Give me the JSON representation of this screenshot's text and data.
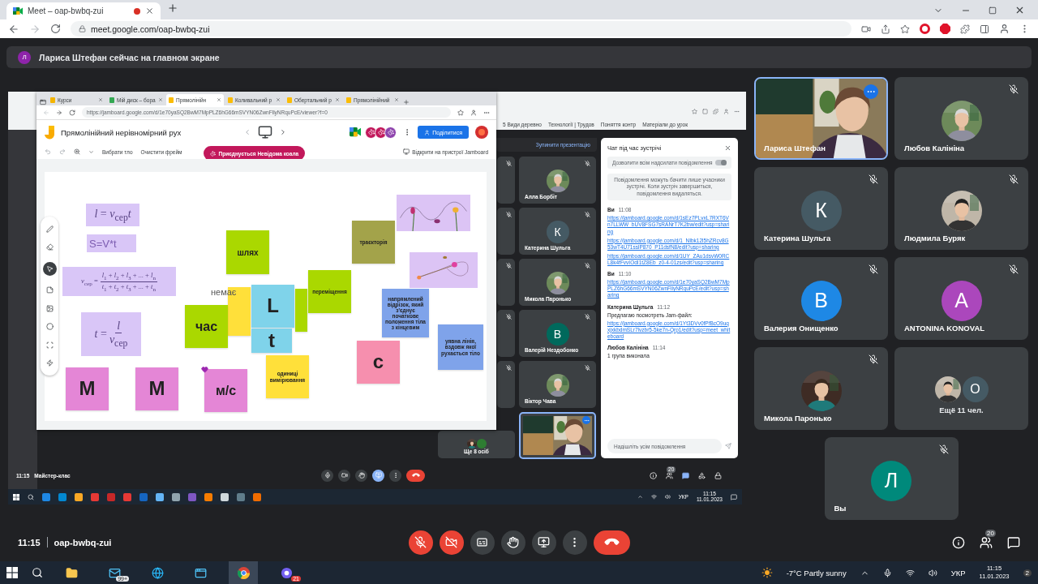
{
  "browser": {
    "tab": "Meet – oap-bwbq-zui",
    "url": "meet.google.com/oap-bwbq-zui"
  },
  "banner": {
    "avatar": "Л",
    "text": "Лариса Штефан сейчас на главном экране"
  },
  "shared": {
    "back_bookmarks": [
      "5 Види деревно",
      "Технології | Трудов",
      "Поняття контр",
      "Матеріали до урок"
    ],
    "inner_browser": {
      "tabs": [
        {
          "label": "Курси",
          "selected": false
        },
        {
          "label": "Мій диск – бора",
          "selected": false
        },
        {
          "label": "Прямолінійн",
          "selected": true
        },
        {
          "label": "Коливальний р",
          "selected": false
        },
        {
          "label": "Обертальний р",
          "selected": false
        },
        {
          "label": "Прямолінійний",
          "selected": false
        }
      ],
      "url": "https://jamboard.google.com/d/1e70yaSQ2BwM7MpPLZ6hG66mSVYN06ZwnFllyNRquPcE/viewer?f=0"
    },
    "jamboard": {
      "title": "Прямолінійний нерівномірний рух",
      "share": "Поділитися",
      "background_button": "Вибрати тло",
      "clear_button": "Очистити фрейм",
      "joined_chip": "Приєднується Невідома коала",
      "open_device": "Відкрити на пристрої Jamboard",
      "items": [
        {
          "kind": "formula",
          "text": "*l* = *v*$_{сер}$*t*"
        },
        {
          "kind": "text_box",
          "text": "S=V*t"
        },
        {
          "kind": "fraction",
          "left": "*v*$_{сер}$ =",
          "numerator": "*l*$_{1}$ + *l*$_{2}$ + *l*$_{3}$ + ... + *l*$_{n}$",
          "denominator": "*t*$_{1}$ + *t*$_{2}$ + *t*$_{3}$ + ... + *t*$_{n}$"
        },
        {
          "kind": "fraction",
          "left": "*t* =",
          "numerator": "*l*",
          "denominator": "*v*$_{сер}$"
        },
        {
          "kind": "sticky",
          "color": "#e486d6",
          "text": "М"
        },
        {
          "kind": "sticky",
          "color": "#e486d6",
          "text": "М"
        },
        {
          "kind": "sticky",
          "color": "#e486d6",
          "text": "м/с"
        },
        {
          "kind": "sticky",
          "color": "#aad800",
          "text": "шлях"
        },
        {
          "kind": "sticky",
          "color": "#ffe03a"
        },
        {
          "kind": "label",
          "text": "немає"
        },
        {
          "kind": "sticky",
          "color": "#aad800",
          "text": "час"
        },
        {
          "kind": "sticky",
          "color": "#aad800"
        },
        {
          "kind": "sticky",
          "color": "#7fd3ea",
          "text": "L"
        },
        {
          "kind": "sticky",
          "color": "#7fd3ea",
          "text": "t"
        },
        {
          "kind": "sticky",
          "color": "#aad800",
          "text": "переміщення"
        },
        {
          "kind": "sticky",
          "color": "#ffe03a",
          "text": "одиниці вимірювання"
        },
        {
          "kind": "sticky",
          "color": "#a3a34a",
          "text": "траєкторія"
        },
        {
          "kind": "picture"
        },
        {
          "kind": "picture"
        },
        {
          "kind": "sticky",
          "color": "#7fa3ea",
          "text": "напрямлений відрізок, який з'єднує початкове положення тіла з кінцевим"
        },
        {
          "kind": "sticky",
          "color": "#f68fae",
          "text": "с"
        },
        {
          "kind": "sticky",
          "color": "#7fa3ea",
          "text": "уявна лінія, вздовж якої рухається тіло"
        }
      ]
    },
    "stop_presenting": "Зупинити презентацію",
    "tiles": [
      {
        "kind": "covered",
        "muted": true
      },
      {
        "name": "Алла Борбіт",
        "muted": true
      },
      {
        "kind": "covered",
        "muted": true
      },
      {
        "kind": "letter",
        "name": "Катерина Шульга",
        "letter": "К",
        "color": "#455a64",
        "muted": true
      },
      {
        "kind": "covered",
        "muted": true
      },
      {
        "name": "Микола Паронько",
        "muted": true
      },
      {
        "kind": "covered",
        "muted": true
      },
      {
        "kind": "letter",
        "name": "Валерій Нездобонко",
        "letter": "В",
        "color": "#00695c",
        "muted": true
      },
      {
        "kind": "covered",
        "muted": true
      },
      {
        "name": "Віктор Чава",
        "muted": true
      },
      {
        "kind": "others",
        "name": "Ще 8 осіб",
        "muted": false
      },
      {
        "kind": "video",
        "muted": false
      }
    ],
    "chat": {
      "title": "Чат під час зустрічі",
      "allow_label": "Дозволити всім надсилати повідомлення",
      "allow_on": true,
      "notice": "Повідомлення можуть бачити лише учасники зустрічі. Коли зустріч завершиться, повідомлення видаляться.",
      "messages": [
        {
          "sender": "Ви",
          "time": "11:08",
          "lines": [
            {
              "kind": "link",
              "text": "https://jamboard.google.com/d/1sEz7PLvxL7RXT6Vn7LLWW_bUV8FSG7sRANrT7K2bw/edit?usp=sharing"
            },
            {
              "kind": "link",
              "text": "https://jamboard.google.com/d/1_NIbk12l5hZRcv8G53wT4U71sslP870_P11dsfN8/edit?usp=sharing"
            },
            {
              "kind": "link",
              "text": "https://jamboard.google.com/d/1UY_ZAu1dsvW0RCL8k4fFvvIOdI1tZ8Eb_z0-4-01zs/edit?usp=sharing"
            }
          ]
        },
        {
          "sender": "Ви",
          "time": "11:10",
          "lines": [
            {
              "kind": "link",
              "text": "https://jamboard.google.com/d/1e70yaSQ2BwM7MpPLZ6hG66mSVYN06ZwnFllyNRquPcE/edit?usp=sharing"
            }
          ]
        },
        {
          "sender": "Катерина Шульга",
          "time": "11:12",
          "lines": [
            {
              "kind": "text",
              "text": "Предлагаю посмотреть Jam-файл:"
            },
            {
              "kind": "link",
              "text": "https://jamboard.google.com/d/1Yt3DVv0fPfBcO9uqxjxkbdmSLr7lvzbr5-5ke7n-Qrp1/edit?usp=meet_whiteboard"
            }
          ]
        },
        {
          "sender": "Любов Калініна",
          "time": "11:14",
          "lines": [
            {
              "kind": "text",
              "text": "1 група  виконала"
            }
          ]
        }
      ],
      "placeholder": "Надішліть усім повідомлення"
    },
    "bar": {
      "time": "11:15",
      "title": "Майстер-клас",
      "people_count": "20",
      "controls": [
        {
          "kind": "mic",
          "color": "#3c4043"
        },
        {
          "kind": "camera",
          "color": "#3c4043"
        },
        {
          "kind": "hand",
          "color": "#3c4043"
        },
        {
          "kind": "present",
          "color": "#8ab4f8"
        },
        {
          "kind": "more",
          "color": "#3c4043"
        },
        {
          "kind": "hangup",
          "color": "#ea4335"
        }
      ]
    },
    "taskbar": {
      "lang": "УКР",
      "time": "11:15",
      "date": "11.01.2023"
    }
  },
  "tiles": [
    {
      "kind": "video",
      "name": "Лариса Штефан",
      "muted": false,
      "highlighted": true
    },
    {
      "name": "Любов Калініна",
      "muted": true,
      "highlighted": false
    },
    {
      "kind": "letter",
      "name": "Катерина Шульга",
      "letter": "К",
      "color": "#455a64",
      "muted": true,
      "highlighted": false
    },
    {
      "name": "Людмила Буряк",
      "muted": true,
      "highlighted": false
    },
    {
      "kind": "letter",
      "name": "Валерия Онищенко",
      "letter": "В",
      "color": "#1e88e5",
      "muted": true,
      "highlighted": false
    },
    {
      "kind": "letter",
      "name": "ANTONINA KONOVAL",
      "letter": "A",
      "color": "#ab47bc",
      "muted": true,
      "highlighted": false
    },
    {
      "name": "Микола Паронько",
      "muted": true,
      "highlighted": false
    },
    {
      "kind": "others",
      "name": "Ещё 11 чел.",
      "letter": "О",
      "color": "#455a64",
      "muted": false,
      "highlighted": false
    },
    {
      "kind": "letter",
      "name": "Вы",
      "letter": "Л",
      "color": "#00897b",
      "muted": true,
      "highlighted": false
    }
  ],
  "bottom": {
    "time": "11:15",
    "code": "oap-bwbq-zui",
    "people_count": "20",
    "controls": [
      {
        "kind": "mic_off",
        "color": "#ea4335"
      },
      {
        "kind": "camera_off",
        "color": "#ea4335"
      },
      {
        "kind": "captions",
        "color": "#3c4043"
      },
      {
        "kind": "hand",
        "color": "#3c4043"
      },
      {
        "kind": "present",
        "color": "#3c4043"
      },
      {
        "kind": "more",
        "color": "#3c4043"
      },
      {
        "kind": "hangup",
        "color": "#ea4335"
      }
    ]
  },
  "taskbar": {
    "mail_badge": "99+",
    "viber_badge": "21",
    "weather": "-7°C Partly sunny",
    "lang": "УКР",
    "time": "11:15",
    "date": "11.01.2023",
    "notifications": "2"
  }
}
